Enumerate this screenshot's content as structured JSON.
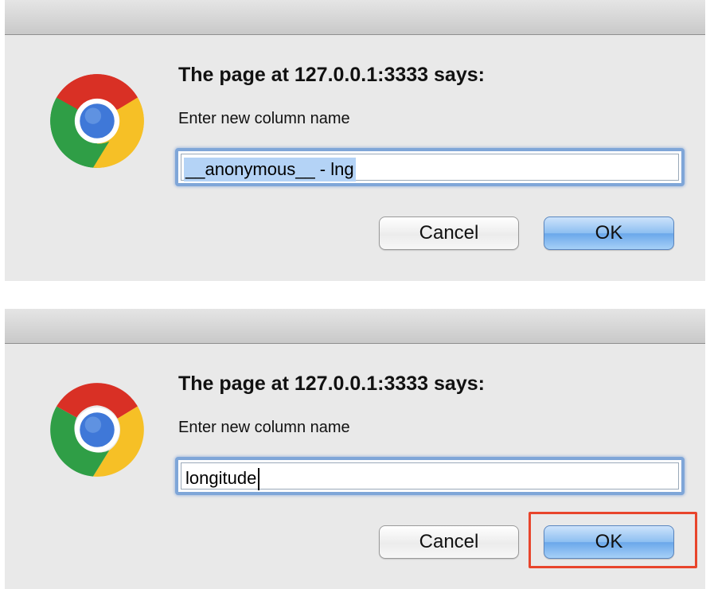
{
  "dialogs": [
    {
      "heading": "The page at 127.0.0.1:3333 says:",
      "message": "Enter new column name",
      "input_value": "__anonymous__ - lng",
      "input_selected": true,
      "cancel_label": "Cancel",
      "ok_label": "OK"
    },
    {
      "heading": "The page at 127.0.0.1:3333 says:",
      "message": "Enter new column name",
      "input_value": "longitude",
      "input_selected": false,
      "cancel_label": "Cancel",
      "ok_label": "OK"
    }
  ],
  "icons": {
    "app_logo": "chrome-logo-icon"
  },
  "colors": {
    "selection": "#b4d3f6",
    "focus_ring": "#7fa6d8",
    "ok_button": "#6aa7ea",
    "annotation": "#e8452c"
  }
}
